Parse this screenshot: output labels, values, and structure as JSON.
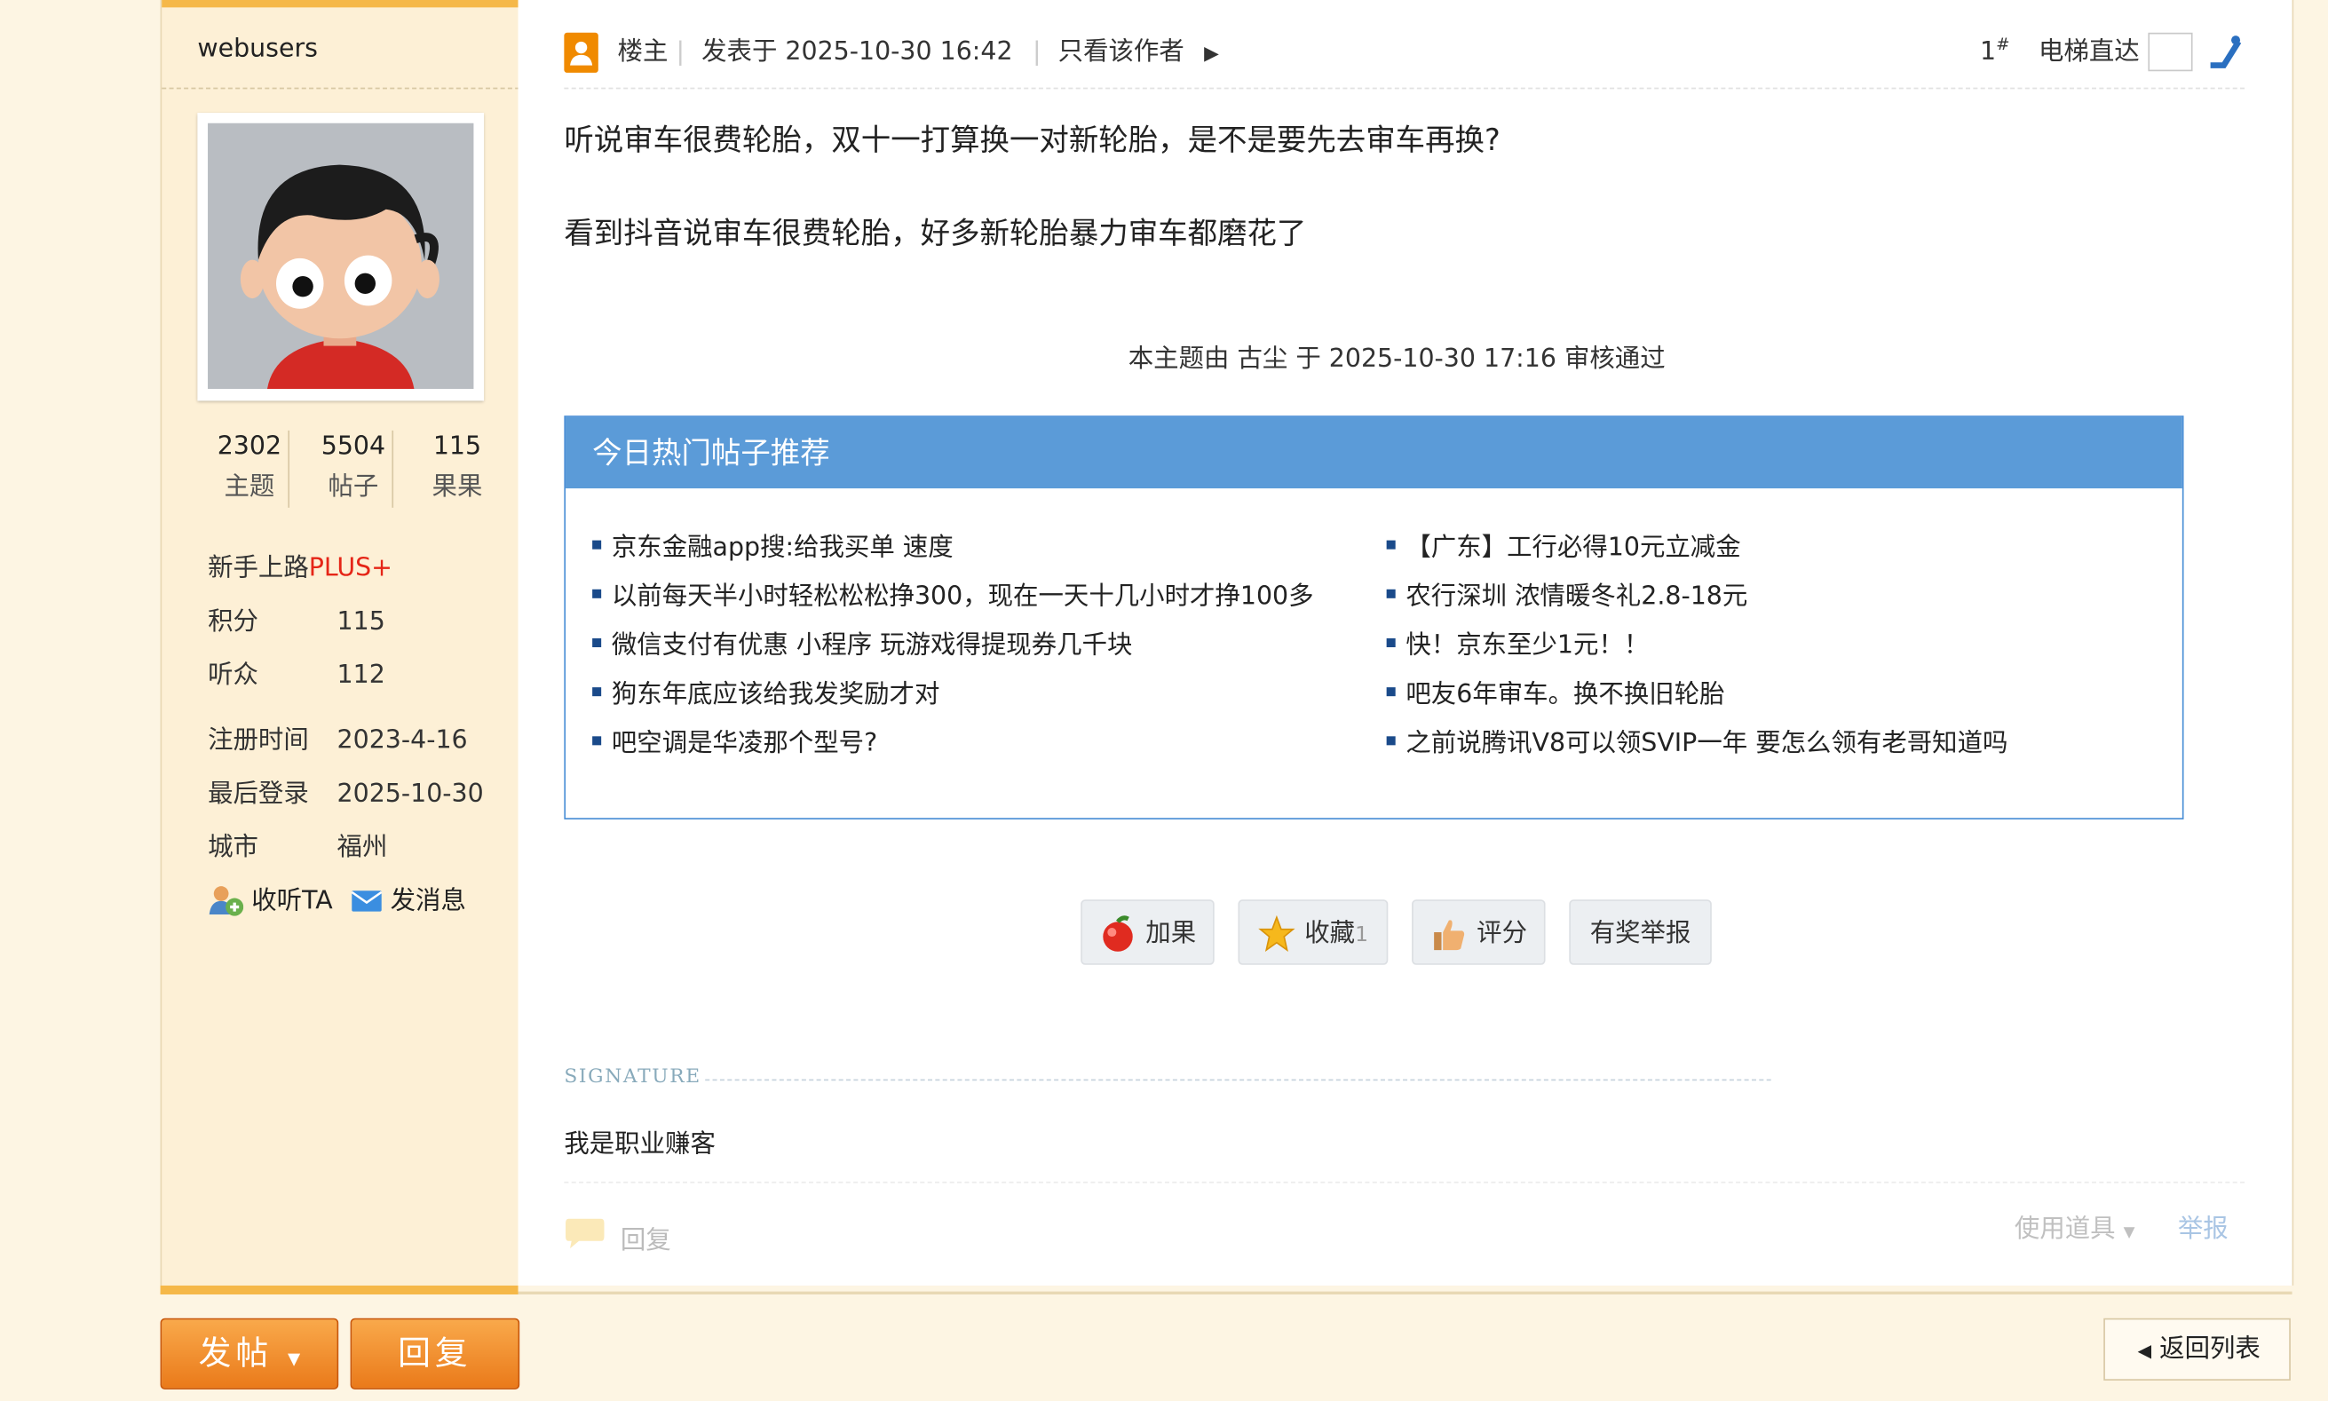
{
  "author": {
    "username": "webusers",
    "stats": [
      {
        "num": "2302",
        "label": "主题"
      },
      {
        "num": "5504",
        "label": "帖子"
      },
      {
        "num": "115",
        "label": "果果"
      }
    ],
    "level": "新手上路",
    "level_badge": "PLUS+",
    "info": [
      {
        "key": "积分",
        "value": "115"
      },
      {
        "key": "听众",
        "value": "112"
      },
      {
        "key": "注册时间",
        "value": "2023-4-16"
      },
      {
        "key": "最后登录",
        "value": "2025-10-30"
      },
      {
        "key": "城市",
        "value": "福州"
      }
    ],
    "follow_label": "收听TA",
    "message_label": "发消息"
  },
  "post": {
    "louzhu": "楼主",
    "posted": "发表于 2025-10-30 16:42",
    "only_author": "只看该作者",
    "floor_num": "1",
    "floor_mark": "#",
    "elevator": "电梯直达",
    "lines": [
      "听说审车很费轮胎，双十一打算换一对新轮胎，是不是要先去审车再换?",
      "看到抖音说审车很费轮胎，好多新轮胎暴力审车都磨花了"
    ],
    "audit": "本主题由 古尘 于 2025-10-30 17:16 审核通过"
  },
  "hot": {
    "title": "今日热门帖子推荐",
    "left": [
      "京东金融app搜:给我买单 速度",
      "以前每天半小时轻松松松挣300，现在一天十几小时才挣100多",
      "微信支付有优惠 小程序 玩游戏得提现券几千块",
      "狗东年底应该给我发奖励才对",
      "吧空调是华凌那个型号?"
    ],
    "right": [
      "【广东】工行必得10元立减金",
      "农行深圳 浓情暖冬礼2.8-18元",
      "快！京东至少1元！！",
      "吧友6年审车。换不换旧轮胎",
      "之前说腾讯V8可以领SVIP一年 要怎么领有老哥知道吗"
    ]
  },
  "actions": {
    "add_fruit": "加果",
    "favorite": "收藏",
    "favorite_count": "1",
    "rate": "评分",
    "report_reward": "有奖举报"
  },
  "signature": {
    "label": "SIGNATURE",
    "text": "我是职业赚客"
  },
  "footer_links": {
    "reply": "回复",
    "tools": "使用道具",
    "report": "举报"
  },
  "bottom": {
    "post_btn": "发帖",
    "reply_btn": "回复",
    "back_btn": "返回列表"
  },
  "colors": {
    "accent_orange": "#f5b849",
    "hot_header": "#5b9bd8",
    "plus_red": "#e52517"
  }
}
